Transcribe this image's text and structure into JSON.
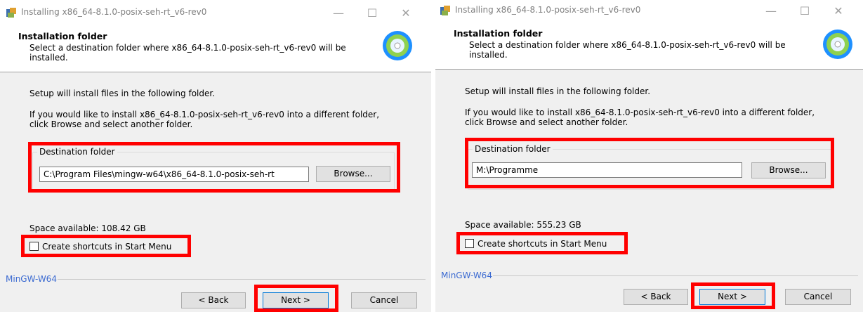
{
  "left": {
    "title": "Installing x86_64-8.1.0-posix-seh-rt_v6-rev0",
    "header_title": "Installation folder",
    "header_subtitle": "Select a destination folder where x86_64-8.1.0-posix-seh-rt_v6-rev0 will be installed.",
    "intro": "Setup will install files in the following folder.",
    "instructions": "If you would like to install x86_64-8.1.0-posix-seh-rt_v6-rev0 into a different folder, click Browse and select another folder.",
    "group_label": "Destination folder",
    "path_value": "C:\\Program Files\\mingw-w64\\x86_64-8.1.0-posix-seh-rt",
    "browse": "Browse...",
    "space": "Space available: 108.42 GB",
    "shortcut_label": "Create shortcuts in Start Menu",
    "brand": "MinGW-W64",
    "back": "< Back",
    "next": "Next >",
    "cancel": "Cancel"
  },
  "right": {
    "title": "Installing x86_64-8.1.0-posix-seh-rt_v6-rev0",
    "header_title": "Installation folder",
    "header_subtitle": "Select a destination folder where x86_64-8.1.0-posix-seh-rt_v6-rev0 will be installed.",
    "intro": "Setup will install files in the following folder.",
    "instructions": "If you would like to install x86_64-8.1.0-posix-seh-rt_v6-rev0 into a different folder, click Browse and select another folder.",
    "group_label": "Destination folder",
    "path_value": "M:\\Programme",
    "browse": "Browse...",
    "space": "Space available: 555.23 GB",
    "shortcut_label": "Create shortcuts in Start Menu",
    "brand": "MinGW-W64",
    "back": "< Back",
    "next": "Next >",
    "cancel": "Cancel"
  },
  "window_controls": {
    "minimize": "—",
    "maximize": "☐",
    "close": "✕"
  },
  "icons": {
    "app": "installer-icon",
    "header": "cd-disc-icon"
  },
  "colors": {
    "highlight": "#ff0000",
    "brand_text": "#3b6ad1",
    "cd_blue": "#1e90ff"
  }
}
